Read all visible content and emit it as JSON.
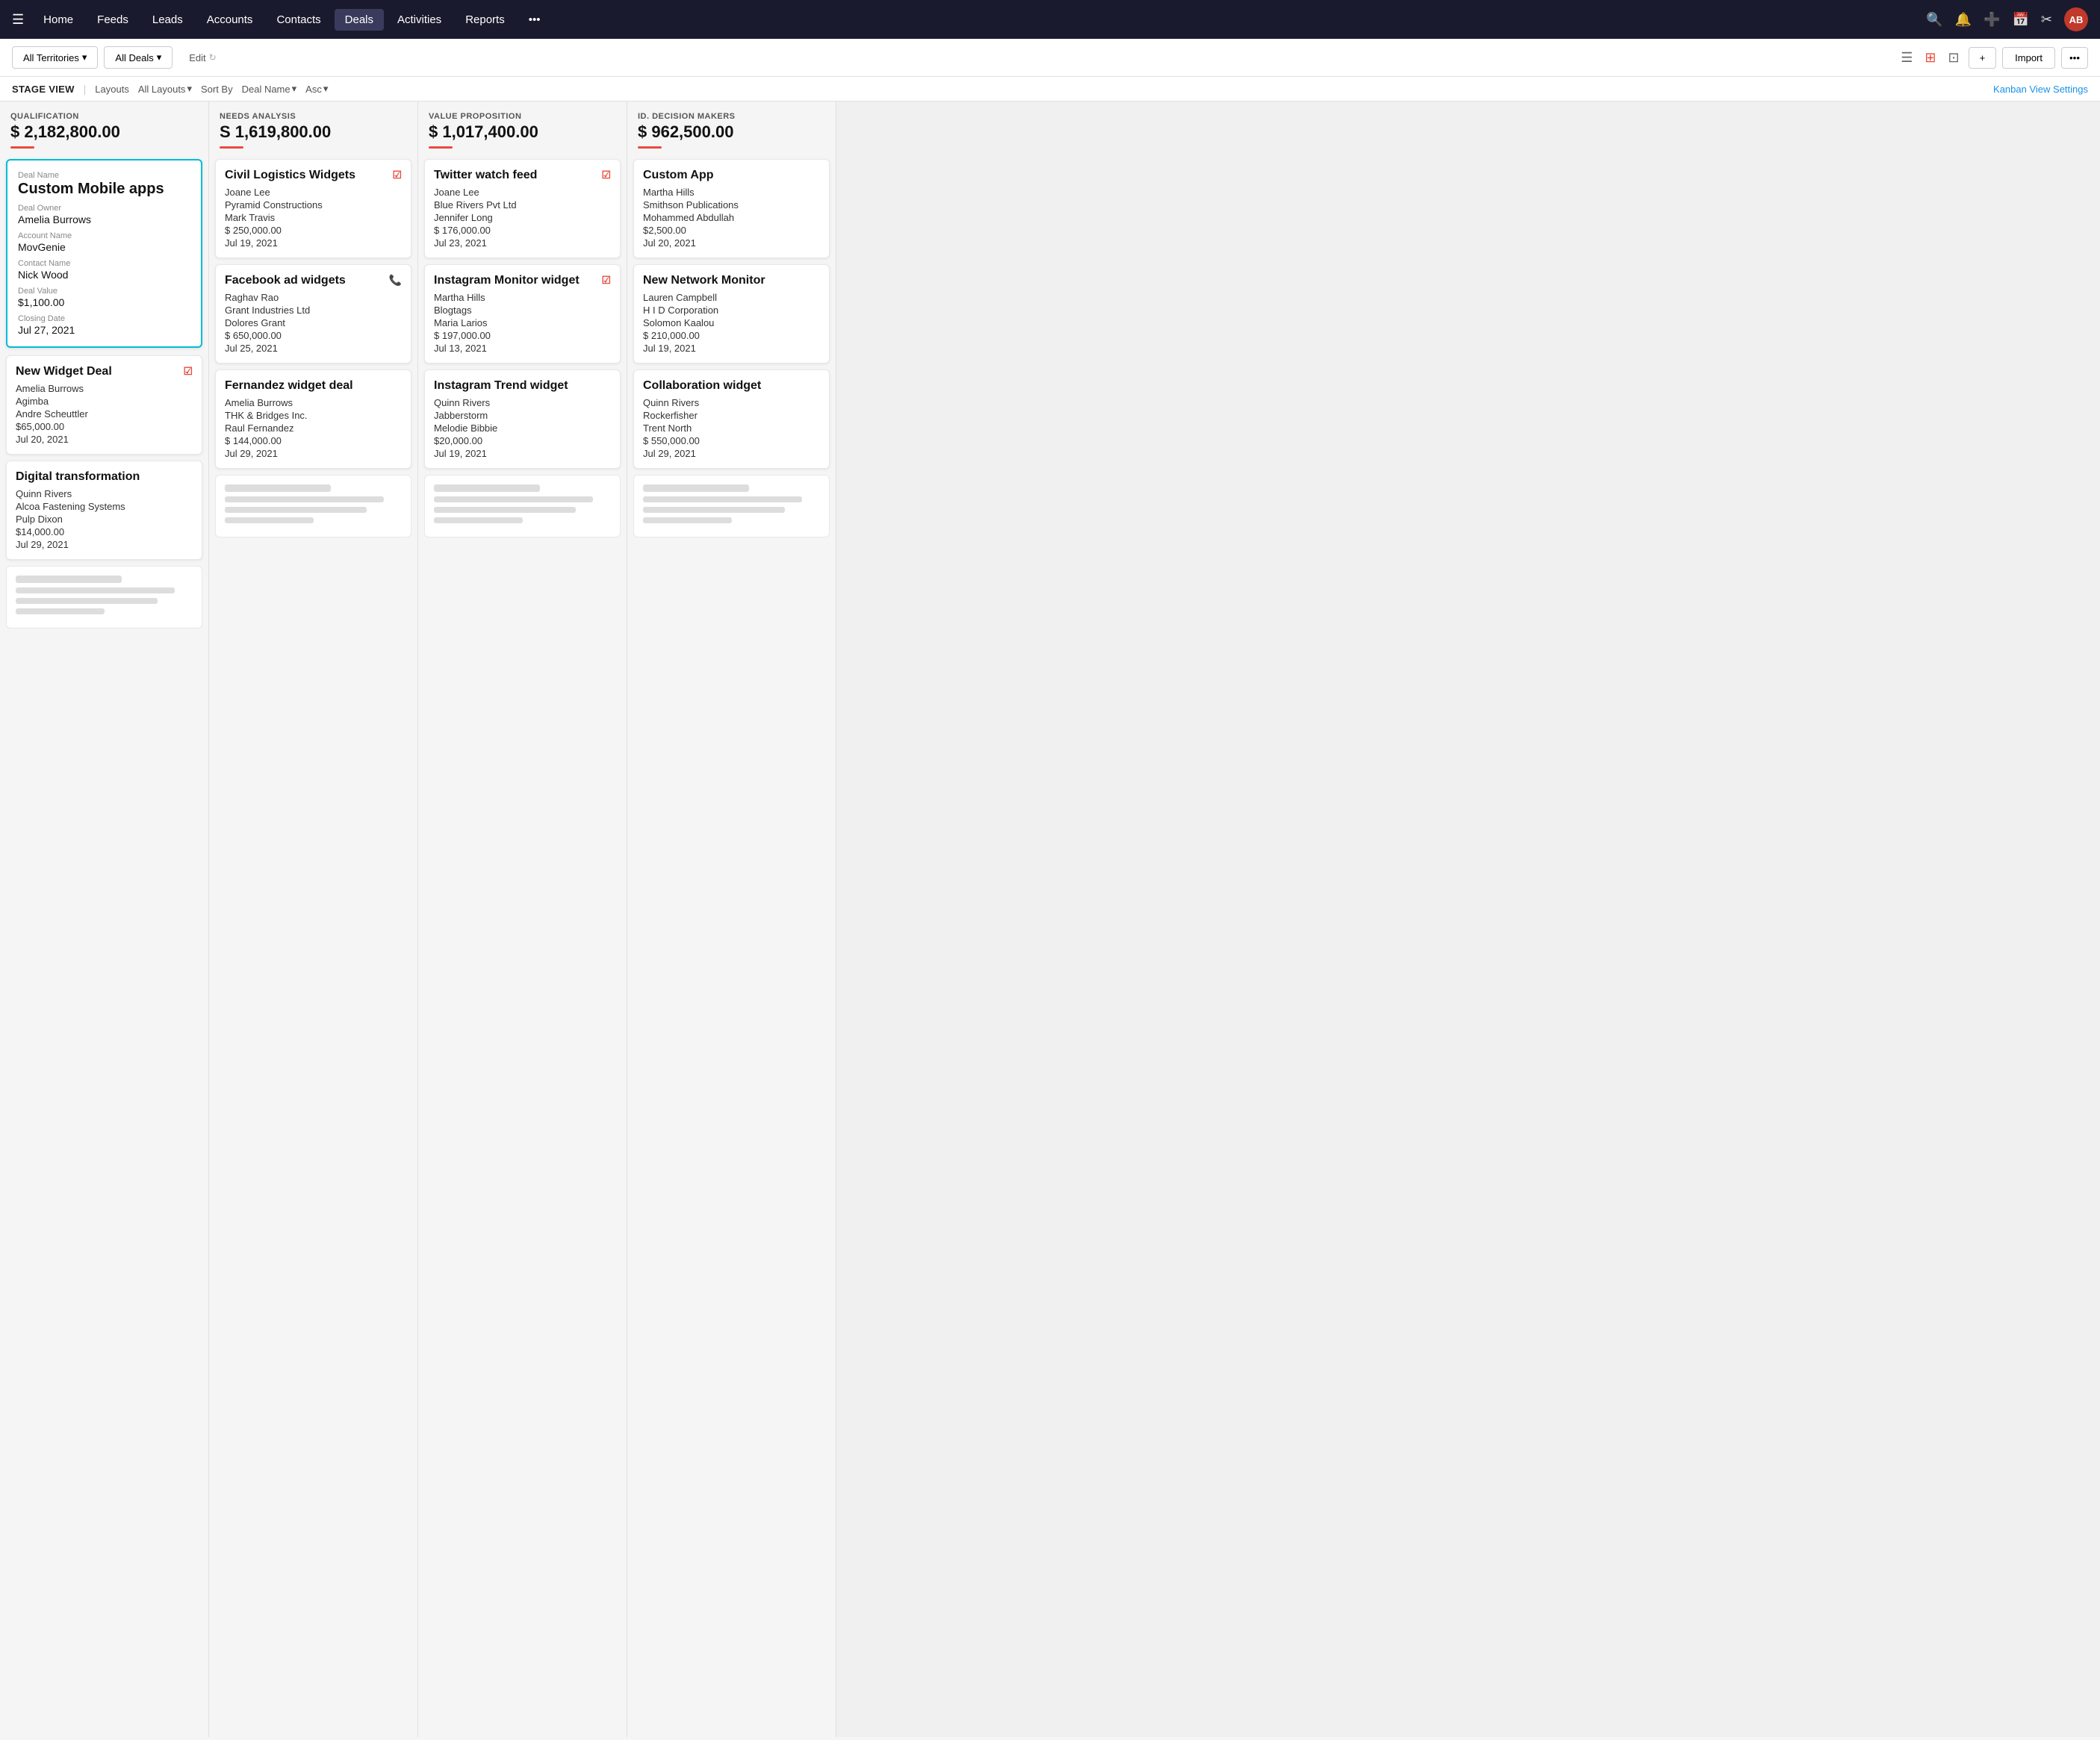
{
  "navbar": {
    "hamburger": "☰",
    "items": [
      {
        "label": "Home",
        "active": false
      },
      {
        "label": "Feeds",
        "active": false
      },
      {
        "label": "Leads",
        "active": false
      },
      {
        "label": "Accounts",
        "active": false
      },
      {
        "label": "Contacts",
        "active": false
      },
      {
        "label": "Deals",
        "active": true
      },
      {
        "label": "Activities",
        "active": false
      },
      {
        "label": "Reports",
        "active": false
      },
      {
        "label": "•••",
        "active": false
      }
    ],
    "icons": [
      "🔍",
      "🔔",
      "+",
      "📅",
      "✂"
    ]
  },
  "toolbar": {
    "territory_label": "All Territories",
    "deals_label": "All Deals",
    "edit_label": "Edit",
    "add_label": "+",
    "import_label": "Import",
    "more_label": "•••"
  },
  "stage_toolbar": {
    "label": "STAGE VIEW",
    "layouts_label": "Layouts",
    "all_layouts_label": "All Layouts",
    "sort_label": "Sort By",
    "sort_field": "Deal Name",
    "sort_dir": "Asc",
    "kanban_settings": "Kanban View Settings"
  },
  "columns": [
    {
      "id": "qualification",
      "stage": "QUALIFICATION",
      "amount": "$ 2,182,800.00",
      "cards": [
        {
          "id": "custom-mobile",
          "expanded": true,
          "deal_name_label": "Deal Name",
          "deal_name": "Custom Mobile apps",
          "deal_owner_label": "Deal Owner",
          "deal_owner": "Amelia Burrows",
          "account_name_label": "Account Name",
          "account_name": "MovGenie",
          "contact_name_label": "Contact Name",
          "contact_name": "Nick Wood",
          "deal_value_label": "Deal Value",
          "deal_value": "$1,100.00",
          "closing_date_label": "Closing Date",
          "closing_date": "Jul 27, 2021"
        },
        {
          "id": "new-widget-deal",
          "title": "New Widget Deal",
          "has_edit": true,
          "person": "Amelia Burrows",
          "company": "Agimba",
          "contact": "Andre Scheuttler",
          "amount": "$65,000.00",
          "date": "Jul 20, 2021"
        },
        {
          "id": "digital-transformation",
          "title": "Digital transformation",
          "person": "Quinn Rivers",
          "company": "Alcoa Fastening Systems",
          "contact": "Pulp Dixon",
          "amount": "$14,000.00",
          "date": "Jul 29, 2021"
        }
      ],
      "skeleton": true
    },
    {
      "id": "needs-analysis",
      "stage": "NEEDS ANALYSIS",
      "amount": "S 1,619,800.00",
      "cards": [
        {
          "id": "civil-logistics",
          "title": "Civil Logistics Widgets",
          "has_edit": true,
          "person": "Joane Lee",
          "company": "Pyramid Constructions",
          "contact": "Mark Travis",
          "amount": "$ 250,000.00",
          "date": "Jul 19, 2021"
        },
        {
          "id": "facebook-ad",
          "title": "Facebook ad widgets",
          "has_phone": true,
          "person": "Raghav Rao",
          "company": "Grant Industries Ltd",
          "contact": "Dolores Grant",
          "amount": "$ 650,000.00",
          "date": "Jul 25, 2021"
        },
        {
          "id": "fernandez-widget",
          "title": "Fernandez widget deal",
          "person": "Amelia Burrows",
          "company": "THK & Bridges Inc.",
          "contact": "Raul Fernandez",
          "amount": "$ 144,000.00",
          "date": "Jul 29, 2021"
        }
      ],
      "skeleton": true
    },
    {
      "id": "value-proposition",
      "stage": "VALUE PROPOSITION",
      "amount": "$ 1,017,400.00",
      "cards": [
        {
          "id": "twitter-watch",
          "title": "Twitter watch feed",
          "has_edit": true,
          "person": "Joane Lee",
          "company": "Blue Rivers Pvt Ltd",
          "contact": "Jennifer Long",
          "amount": "$ 176,000.00",
          "date": "Jul 23, 2021"
        },
        {
          "id": "instagram-monitor",
          "title": "Instagram Monitor widget",
          "has_edit": true,
          "person": "Martha Hills",
          "company": "Blogtags",
          "contact": "Maria Larios",
          "amount": "$ 197,000.00",
          "date": "Jul 13, 2021"
        },
        {
          "id": "instagram-trend",
          "title": "Instagram Trend widget",
          "person": "Quinn Rivers",
          "company": "Jabberstorm",
          "contact": "Melodie Bibbie",
          "amount": "$20,000.00",
          "date": "Jul 19, 2021"
        }
      ],
      "skeleton": true
    },
    {
      "id": "id-decision-makers",
      "stage": "ID. DECISION MAKERS",
      "amount": "$ 962,500.00",
      "cards": [
        {
          "id": "custom-app",
          "title": "Custom App",
          "person": "Martha Hills",
          "company": "Smithson Publications",
          "contact": "Mohammed Abdullah",
          "amount": "$2,500.00",
          "date": "Jul 20, 2021"
        },
        {
          "id": "new-network-monitor",
          "title": "New Network Monitor",
          "person": "Lauren Campbell",
          "company": "H I D Corporation",
          "contact": "Solomon Kaalou",
          "amount": "$ 210,000.00",
          "date": "Jul 19, 2021"
        },
        {
          "id": "collaboration-widget",
          "title": "Collaboration widget",
          "person": "Quinn Rivers",
          "company": "Rockerfisher",
          "contact": "Trent North",
          "amount": "$ 550,000.00",
          "date": "Jul 29, 2021"
        }
      ],
      "skeleton": true
    }
  ]
}
